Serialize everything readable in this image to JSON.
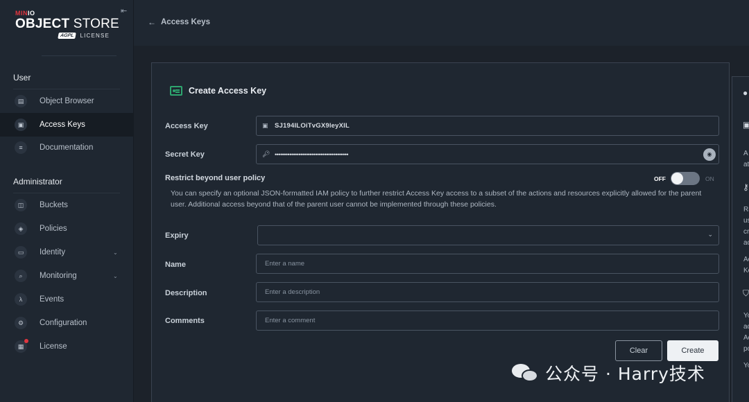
{
  "sidebar": {
    "brand_prefix_red": "MIN",
    "brand_prefix_white": "IO",
    "product_bold": "OBJECT",
    "product_thin": " STORE",
    "license_badge": "AGPL",
    "license_word": "LICENSE",
    "sections": [
      {
        "title": "User",
        "items": [
          {
            "label": "Object Browser",
            "icon": "folder-icon"
          },
          {
            "label": "Access Keys",
            "icon": "id-card-icon",
            "active": true
          },
          {
            "label": "Documentation",
            "icon": "document-icon"
          }
        ]
      },
      {
        "title": "Administrator",
        "items": [
          {
            "label": "Buckets",
            "icon": "bucket-icon"
          },
          {
            "label": "Policies",
            "icon": "shield-icon"
          },
          {
            "label": "Identity",
            "icon": "identity-icon",
            "expandable": true
          },
          {
            "label": "Monitoring",
            "icon": "magnifier-icon",
            "expandable": true
          },
          {
            "label": "Events",
            "icon": "lambda-icon"
          },
          {
            "label": "Configuration",
            "icon": "gear-icon"
          },
          {
            "label": "License",
            "icon": "license-icon"
          }
        ]
      }
    ]
  },
  "topbar": {
    "back_arrow": "←",
    "title": "Access Keys"
  },
  "form": {
    "title": "Create Access Key",
    "access_key": {
      "label": "Access Key",
      "value": "SJ194ILOiTvGX9leyXIL"
    },
    "secret_key": {
      "label": "Secret Key",
      "value": "••••••••••••••••••••••••••••••••••••••••"
    },
    "restrict": {
      "label": "Restrict beyond user policy",
      "toggle_off": "OFF",
      "toggle_on": "ON",
      "toggle_state": "off",
      "description": "You can specify an optional JSON-formatted IAM policy to further restrict Access Key access to a subset of the actions and resources explicitly allowed for the parent user. Additional access beyond that of the parent user cannot be implemented through these policies."
    },
    "expiry": {
      "label": "Expiry",
      "value": ""
    },
    "name": {
      "label": "Name",
      "placeholder": "Enter a name"
    },
    "description": {
      "label": "Description",
      "placeholder": "Enter a description"
    },
    "comments": {
      "label": "Comments",
      "placeholder": "Enter a comment"
    },
    "clear_label": "Clear",
    "create_label": "Create"
  },
  "help_panel": {
    "fragments": [
      "A",
      "at",
      "Ra",
      "us",
      "cr",
      "ac",
      "Ac",
      "Ke",
      "Yo",
      "ac",
      "Ac",
      "po",
      "Yo"
    ]
  },
  "watermark": {
    "text": "公众号 · Harry技术"
  },
  "colors": {
    "accent_green": "#2ea66f",
    "license_dot": "#e0363f",
    "background": "#1c222a",
    "panel": "#1f2731"
  }
}
